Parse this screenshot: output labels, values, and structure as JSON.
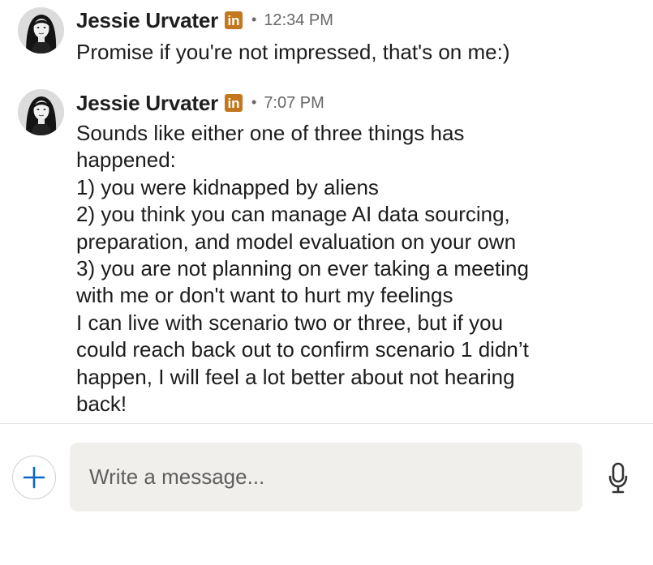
{
  "messages": [
    {
      "sender": "Jessie Urvater",
      "badge": "in",
      "time": "12:34 PM",
      "lines": [
        "Promise if you're not impressed, that's on me:)"
      ]
    },
    {
      "sender": "Jessie Urvater",
      "badge": "in",
      "time": "7:07 PM",
      "lines": [
        "Sounds like either one of three things has",
        "happened:",
        "1) you were kidnapped by aliens",
        "2) you think you can manage AI data sourcing,",
        "preparation, and model evaluation on your own",
        "3) you are not planning on ever taking a meeting",
        "with me or don't want to hurt my feelings",
        "I can live with scenario two or three, but if you",
        "could reach back out to confirm scenario 1 didn’t",
        "happen, I will feel a lot better about not hearing",
        "back!"
      ]
    }
  ],
  "composer": {
    "placeholder": "Write a message...",
    "add_icon": "plus-icon",
    "mic_icon": "microphone-icon"
  },
  "colors": {
    "badge": "#c3781f",
    "add_accent": "#0a66c2",
    "input_bg": "#f1efeb"
  }
}
